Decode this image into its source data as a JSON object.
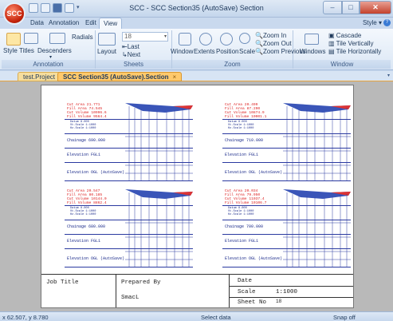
{
  "app": {
    "orb_label": "SCC",
    "title": "SCC - SCC Section35 (AutoSave) Section"
  },
  "window_controls": {
    "minimize": "–",
    "maximize": "□",
    "close": "✕"
  },
  "ribbon_tabs": [
    "Data",
    "Annotation",
    "Edit",
    "View"
  ],
  "ribbon_tabs_display": {
    "t0": "Data",
    "t1": "Annotation",
    "t2": "Edit",
    "t3": "View"
  },
  "style_menu": "Style",
  "ribbon": {
    "annotation_group": {
      "label": "Annotation",
      "radials": "Radials",
      "style": "Style",
      "titles": "Titles",
      "descenders": "Descenders"
    },
    "sheets_group": {
      "label": "Sheets",
      "layout": "Layout",
      "sheet_value": "18",
      "last": "Last",
      "next": "Next"
    },
    "zoom_group": {
      "label": "Zoom",
      "window": "Window",
      "extents": "Extents",
      "position": "Position",
      "scale": "Scale",
      "zoom_in": "Zoom In",
      "zoom_out": "Zoom Out",
      "zoom_previous": "Zoom Previous"
    },
    "window_group": {
      "label": "Window",
      "windows": "Windows",
      "cascade": "Cascade",
      "tile_vertically": "Tile Vertically",
      "tile_horizontally": "Tile Horizontally"
    }
  },
  "doc_tabs": {
    "project": "test.Project",
    "section": "SCC Section35 (AutoSave).Section",
    "close": "×"
  },
  "sections": [
    {
      "cut_area": "Cut Area 21.771",
      "fill_area": "Fill Area 74.545",
      "cut_volume": "Cut Volume 10996.6",
      "fill_volume": "Fill Volume 9564.4",
      "chainage": "Chainage 690.000"
    },
    {
      "cut_area": "Cut Area 20.499",
      "fill_area": "Fill Area 87.290",
      "cut_volume": "Cut Volume 10874.9",
      "fill_volume": "Fill Volume 10001.1",
      "chainage": "Chainage 710.000"
    },
    {
      "cut_area": "Cut Area 20.547",
      "fill_area": "Fill Area 80.185",
      "cut_volume": "Cut Volume 10144.0",
      "fill_volume": "Fill Volume 8862.4",
      "chainage": "Chainage 680.000"
    },
    {
      "cut_area": "Cut Area 20.034",
      "fill_area": "Fill Area 79.950",
      "cut_volume": "Cut Volume 11037.4",
      "fill_volume": "Fill Volume 10106.7",
      "chainage": "Chainage 700.000"
    }
  ],
  "section_common": {
    "datum": "Datum 8.000",
    "vt_scale": "Vt.Scale 1:1000",
    "hz_scale": "Hz.Scale 1:1000",
    "elev_fgl": "Elevation FGL1",
    "elev_ogl": "Elevation OGL (AutoSave)"
  },
  "title_block": {
    "job_title": "Job Title",
    "prepared_by": "Prepared By",
    "author": "SmacL",
    "date": "Date",
    "scale_label": "Scale",
    "scale_value": "1:1000",
    "sheet_label": "Sheet No",
    "sheet_value": "18"
  },
  "status": {
    "coords": "x 62.507, y 8.780",
    "mode": "Select data",
    "snap": "Snap off"
  },
  "colors": {
    "cut": "#dd2222",
    "ground": "#2b3aa0",
    "accent": "#f2b24a"
  }
}
